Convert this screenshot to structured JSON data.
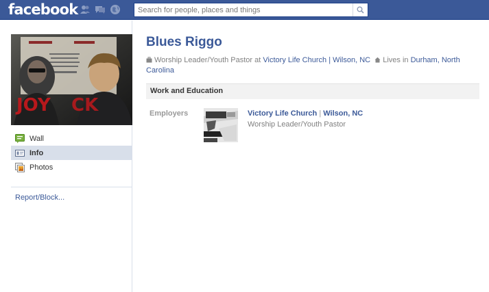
{
  "header": {
    "logo": "facebook",
    "search_placeholder": "Search for people, places and things"
  },
  "profile": {
    "name": "Blues Riggo",
    "work_role": "Worship Leader/Youth Pastor",
    "work_at": "at",
    "work_place": "Victory Life Church | Wilson, NC",
    "lives_in_label": "Lives in",
    "lives_in": "Durham, North Carolina"
  },
  "sidebar": {
    "items": [
      {
        "label": "Wall",
        "icon": "wall-icon"
      },
      {
        "label": "Info",
        "icon": "info-icon",
        "active": true
      },
      {
        "label": "Photos",
        "icon": "photos-icon"
      }
    ],
    "report": "Report/Block..."
  },
  "work_education": {
    "header": "Work and Education",
    "employers_label": "Employers",
    "employer": {
      "name": "Victory Life Church",
      "separator": "|",
      "location": "Wilson, NC",
      "role": "Worship Leader/Youth Pastor"
    }
  },
  "colors": {
    "brand": "#3b5998",
    "active_nav": "#d8dfea"
  }
}
